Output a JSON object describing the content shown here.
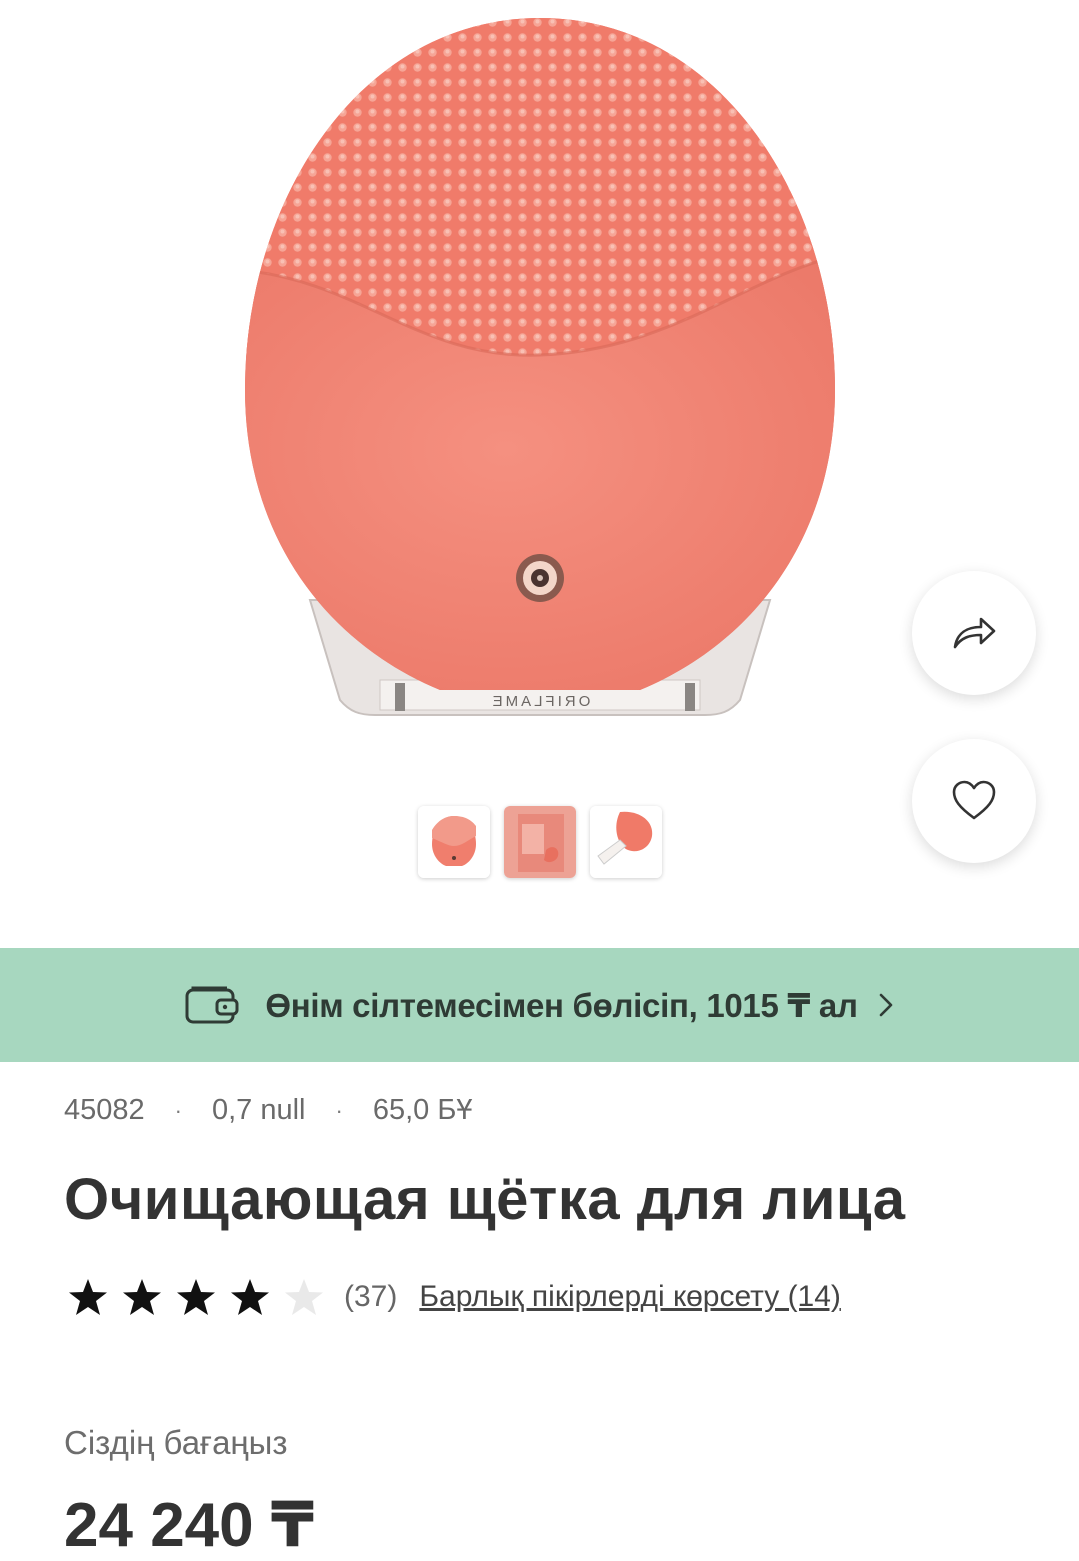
{
  "product": {
    "code": "45082",
    "weight": "0,7 null",
    "points": "65,0 БҰ",
    "title": "Очищающая щётка для лица",
    "brand_mark": "ORIFLAME",
    "rating_value": 4,
    "rating_max": 5,
    "rating_count": "(37)",
    "reviews_link": "Барлық пікірлерді көрсету (14)",
    "price_label": "Сіздің бағаңыз",
    "price": "24 240 ₸"
  },
  "promo": {
    "text": "Өнім сілтемесімен бөлісіп, 1015 ₸ ал"
  },
  "gallery": {
    "thumbnails": [
      "front-view",
      "box-view",
      "side-view"
    ],
    "selected": 0
  },
  "actions": {
    "share_icon": "share-icon",
    "favorite_icon": "heart-icon"
  },
  "colors": {
    "product_coral": "#f08a78",
    "promo_bg": "#a7d7bf",
    "text_dark": "#333333"
  }
}
